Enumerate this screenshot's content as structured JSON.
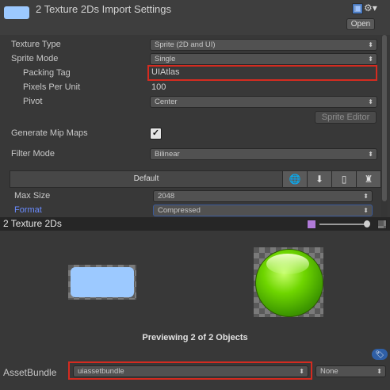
{
  "header": {
    "title": "2 Texture 2Ds Import Settings",
    "open_label": "Open",
    "icons": [
      "help-icon",
      "settings-icon"
    ]
  },
  "settings": {
    "texture_type": {
      "label": "Texture Type",
      "value": "Sprite (2D and UI)"
    },
    "sprite_mode": {
      "label": "Sprite Mode",
      "value": "Single"
    },
    "packing_tag": {
      "label": "Packing Tag",
      "value": "UIAtlas"
    },
    "pixels_per_unit": {
      "label": "Pixels Per Unit",
      "value": "100"
    },
    "pivot": {
      "label": "Pivot",
      "value": "Center"
    },
    "sprite_editor_label": "Sprite Editor",
    "generate_mip_maps": {
      "label": "Generate Mip Maps",
      "checked": "✓"
    },
    "filter_mode": {
      "label": "Filter Mode",
      "value": "Bilinear"
    }
  },
  "platform_tabs": {
    "default_label": "Default",
    "icons": [
      "globe-icon",
      "download-icon",
      "mobile-icon",
      "android-icon"
    ]
  },
  "platform_settings": {
    "max_size": {
      "label": "Max Size",
      "value": "2048"
    },
    "format": {
      "label": "Format",
      "value": "Compressed"
    }
  },
  "preview": {
    "title": "2 Texture 2Ds",
    "caption": "Previewing 2 of 2 Objects",
    "images": [
      "blue-rounded-rectangle",
      "green-sphere"
    ]
  },
  "asset_bundle": {
    "label": "AssetBundle",
    "name": "uiassetbundle",
    "variant": "None"
  },
  "colors": {
    "highlight_border": "#d42b20",
    "format_label": "#6a8cff",
    "thumb_blue": "#9cc9ff",
    "sphere_green": "#54b300"
  }
}
